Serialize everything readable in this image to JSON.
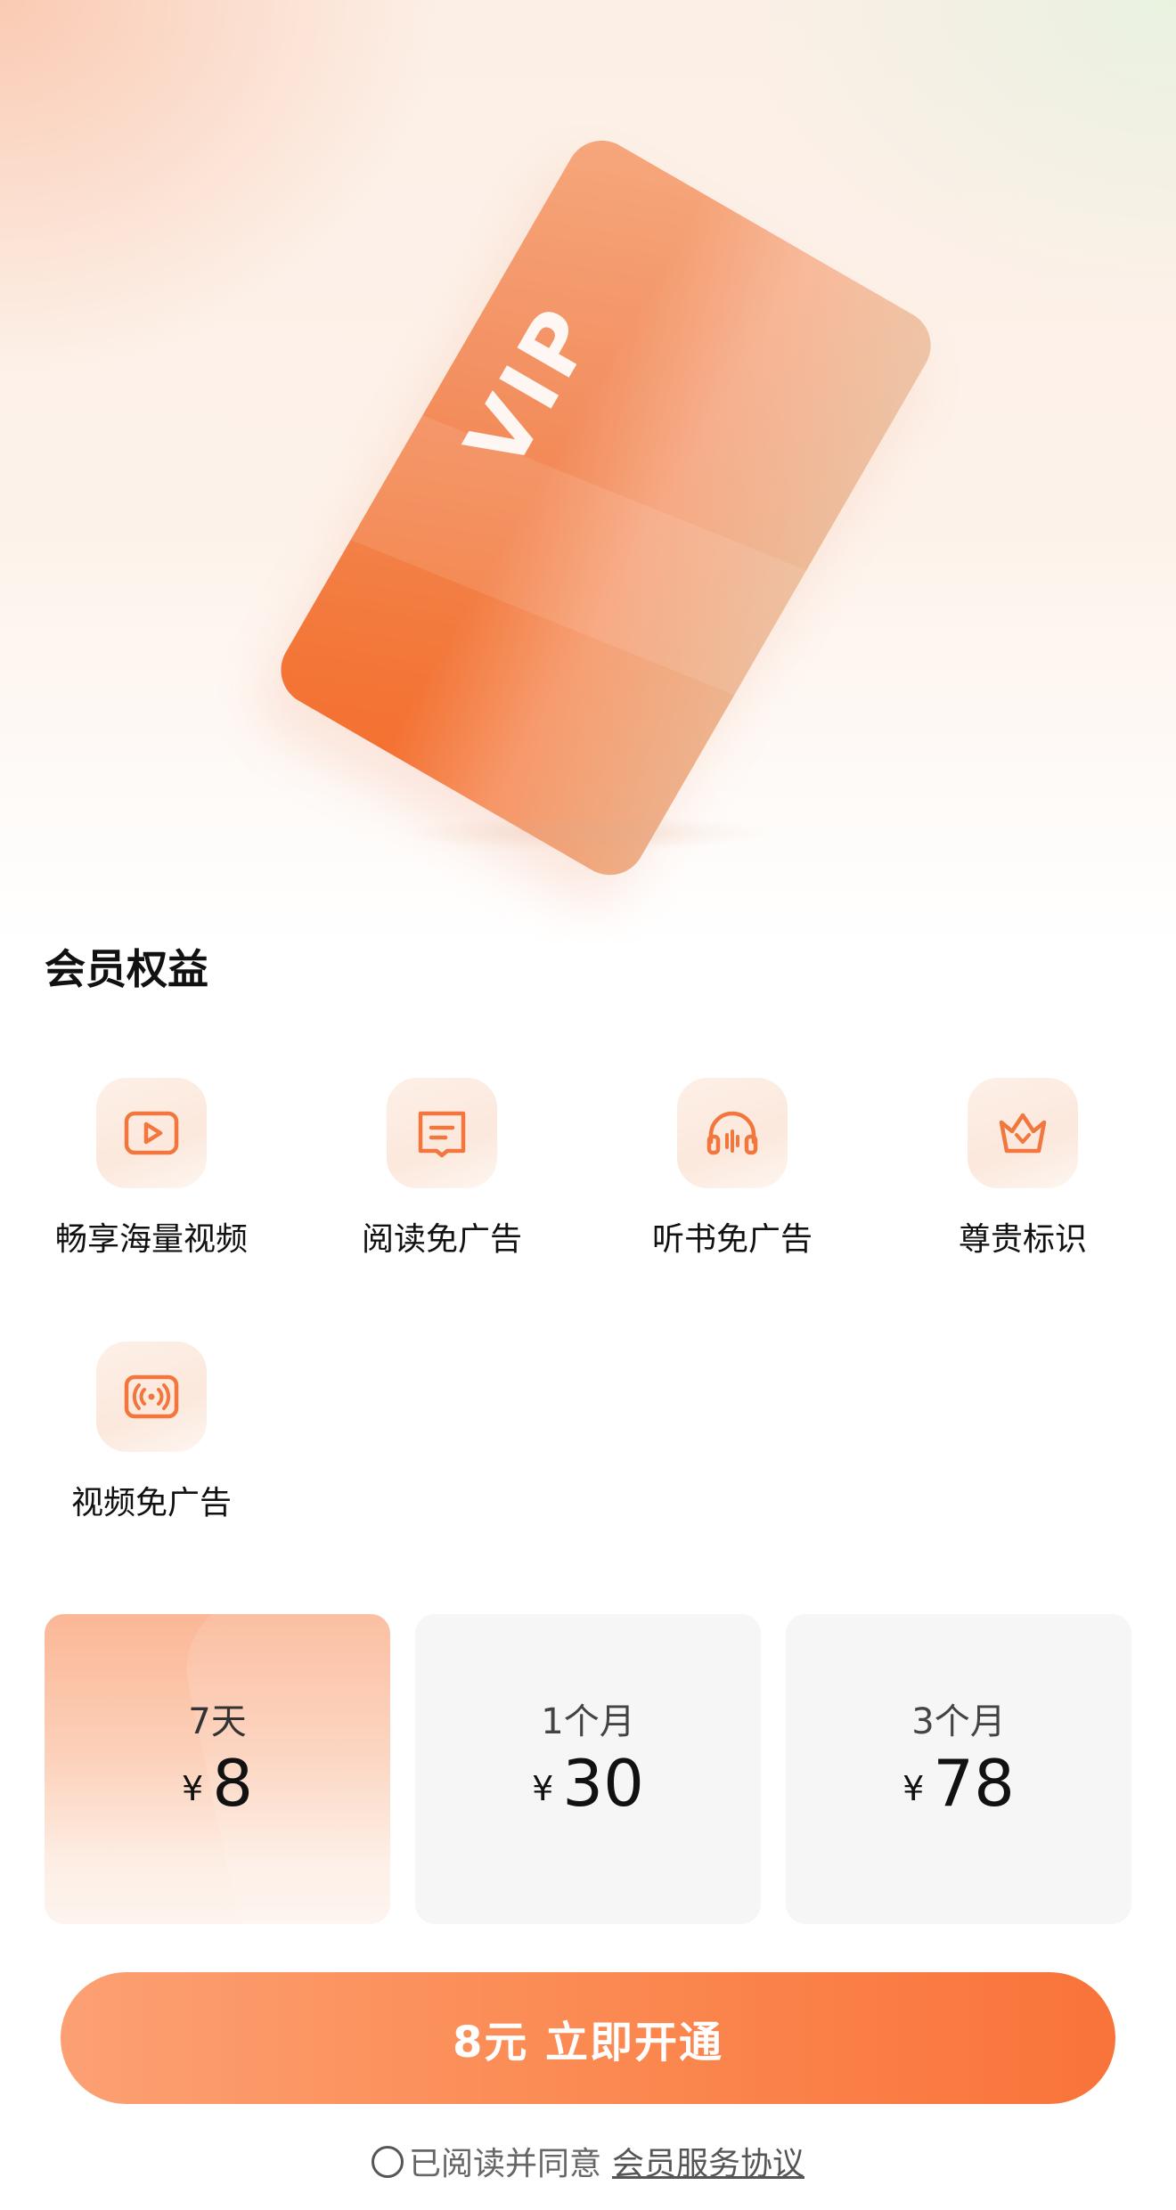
{
  "hero": {
    "card_text": "VIP"
  },
  "benefits": {
    "title": "会员权益",
    "items": [
      {
        "label": "畅享海量视频",
        "icon": "play-icon"
      },
      {
        "label": "阅读免广告",
        "icon": "book-icon"
      },
      {
        "label": "听书免广告",
        "icon": "headphones-icon"
      },
      {
        "label": "尊贵标识",
        "icon": "crown-icon"
      },
      {
        "label": "视频免广告",
        "icon": "broadcast-icon"
      }
    ]
  },
  "plans": [
    {
      "period": "7天",
      "currency": "¥",
      "price": "8",
      "selected": true
    },
    {
      "period": "1个月",
      "currency": "¥",
      "price": "30",
      "selected": false
    },
    {
      "period": "3个月",
      "currency": "¥",
      "price": "78",
      "selected": false
    }
  ],
  "cta": {
    "label": "8元 立即开通"
  },
  "agreement": {
    "text": "已阅读并同意",
    "link": "会员服务协议",
    "checked": false
  },
  "colors": {
    "accent": "#f9733a",
    "accent_light": "#fca073",
    "icon_stroke": "#f1773e",
    "plan_bg": "#f6f6f6"
  }
}
